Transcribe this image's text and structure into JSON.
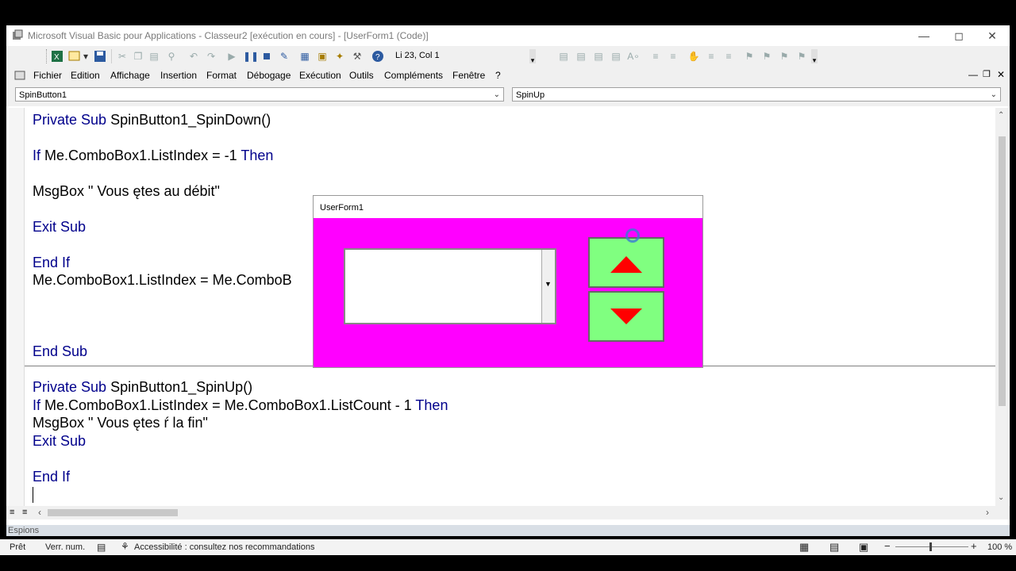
{
  "window": {
    "title": "Microsoft Visual Basic pour Applications - Classeur2 [exécution en cours] - [UserForm1 (Code)]"
  },
  "toolbar": {
    "position_readout": "Li 23, Col 1"
  },
  "menu": {
    "items": [
      "Fichier",
      "Edition",
      "Affichage",
      "Insertion",
      "Format",
      "Débogage",
      "Exécution",
      "Outils",
      "Compléments",
      "Fenêtre",
      "?"
    ]
  },
  "combos": {
    "object": "SpinButton1",
    "procedure": "SpinUp"
  },
  "code": {
    "lines": [
      {
        "kw": "Private Sub",
        "rest": " SpinButton1_SpinDown()"
      },
      {
        "kw": "If",
        "rest": " Me.ComboBox1.ListIndex = -1 ",
        "kw2": "Then"
      },
      {
        "kw": "",
        "rest": "MsgBox \" Vous ętes au débit\""
      },
      {
        "kw": "Exit Sub",
        "rest": ""
      },
      {
        "kw": "End If",
        "rest": ""
      },
      {
        "kw": "",
        "rest": "Me.ComboBox1.ListIndex = Me.ComboB"
      },
      {
        "kw": "End Sub",
        "rest": ""
      },
      {
        "kw": "Private Sub",
        "rest": " SpinButton1_SpinUp()"
      },
      {
        "kw": "If",
        "rest": " Me.ComboBox1.ListIndex = Me.ComboBox1.ListCount - 1 ",
        "kw2": "Then"
      },
      {
        "kw": "",
        "rest": "MsgBox \" Vous ętes ŕ la fin\""
      },
      {
        "kw": "Exit Sub",
        "rest": ""
      },
      {
        "kw": "End If",
        "rest": ""
      }
    ]
  },
  "panel": {
    "label": "Espions"
  },
  "userform": {
    "title": "UserForm1",
    "background": "#ff00ff",
    "spin_color": "#80ff80",
    "arrow_color": "#ff0000"
  },
  "status": {
    "ready": "Prêt",
    "numlock": "Verr. num.",
    "accessibility": "Accessibilité : consultez nos recommandations",
    "zoom": "100 %"
  }
}
